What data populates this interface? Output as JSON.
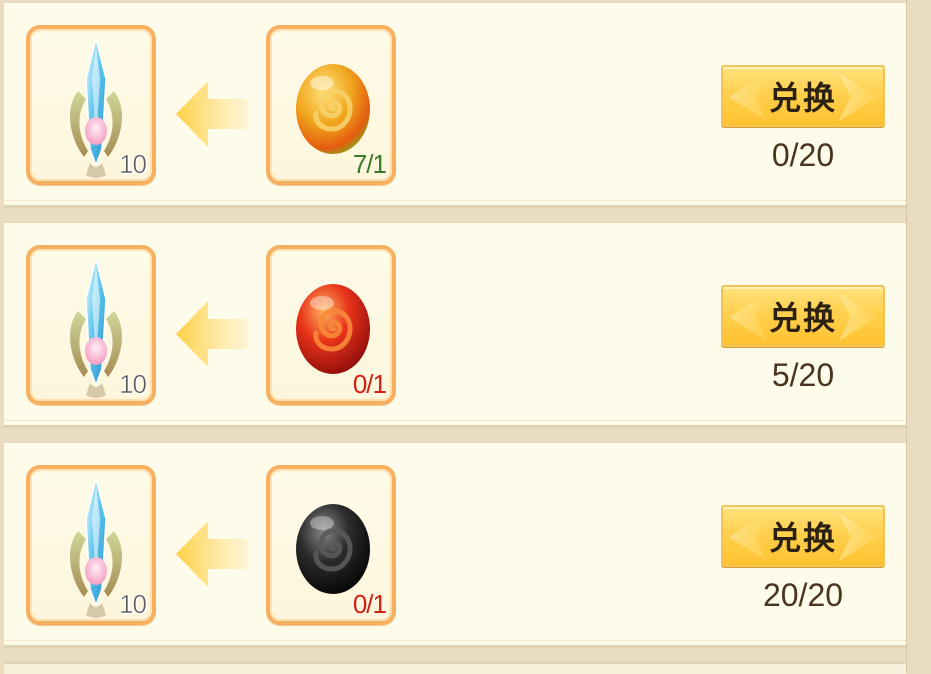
{
  "exchange": {
    "items": [
      {
        "reward": {
          "icon": "ice-crystal-icon",
          "count": "10"
        },
        "cost": {
          "icon": "amber-orb-icon",
          "count": "7/1",
          "status": "ok"
        },
        "button_label": "兑换",
        "progress": "0/20"
      },
      {
        "reward": {
          "icon": "ice-crystal-icon",
          "count": "10"
        },
        "cost": {
          "icon": "red-orb-icon",
          "count": "0/1",
          "status": "lack"
        },
        "button_label": "兑换",
        "progress": "5/20"
      },
      {
        "reward": {
          "icon": "ice-crystal-icon",
          "count": "10"
        },
        "cost": {
          "icon": "black-orb-icon",
          "count": "0/1",
          "status": "lack"
        },
        "button_label": "兑换",
        "progress": "20/20"
      }
    ]
  },
  "colors": {
    "slot_border": "#f7b060",
    "button": "#ffd04e",
    "count_ok": "#3a7a2a",
    "count_lack": "#d41f14",
    "progress_text": "#4a3420"
  }
}
